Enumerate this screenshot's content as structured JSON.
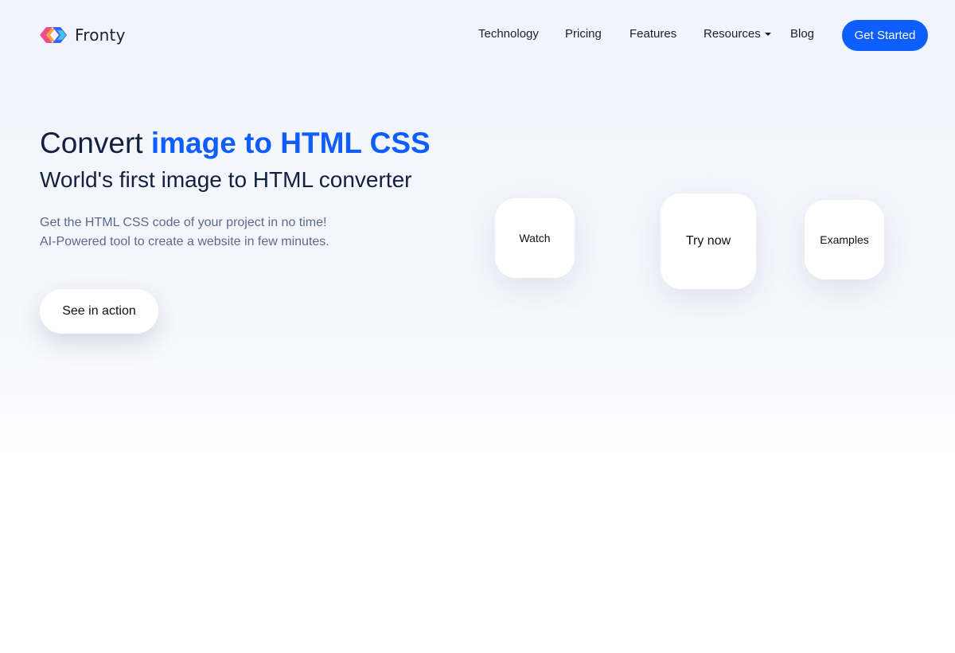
{
  "brand": {
    "name": "Fronty",
    "logo_icon": "fronty-logo-icon",
    "logo_colors": [
      "#ef4d8b",
      "#f4a23c",
      "#3b63f0",
      "#42c3e8"
    ]
  },
  "nav": {
    "items": [
      {
        "label": "Technology"
      },
      {
        "label": "Pricing"
      },
      {
        "label": "Features"
      },
      {
        "label": "Resources",
        "has_dropdown": true
      },
      {
        "label": "Blog"
      }
    ],
    "cta_label": "Get Started"
  },
  "hero": {
    "title_prefix": "Convert",
    "title_highlight": "image to HTML CSS",
    "subtitle": "World's first image to HTML converter",
    "description_lines": [
      "Get the HTML CSS code of your project in no time!",
      "AI-Powered tool to create a website in few minutes."
    ],
    "action_label": "See in action"
  },
  "cards": {
    "watch": "Watch",
    "try": "Try now",
    "examples": "Examples"
  },
  "colors": {
    "accent": "#0d5efc",
    "heading": "#14213d",
    "muted_text": "#5c6a8a"
  }
}
